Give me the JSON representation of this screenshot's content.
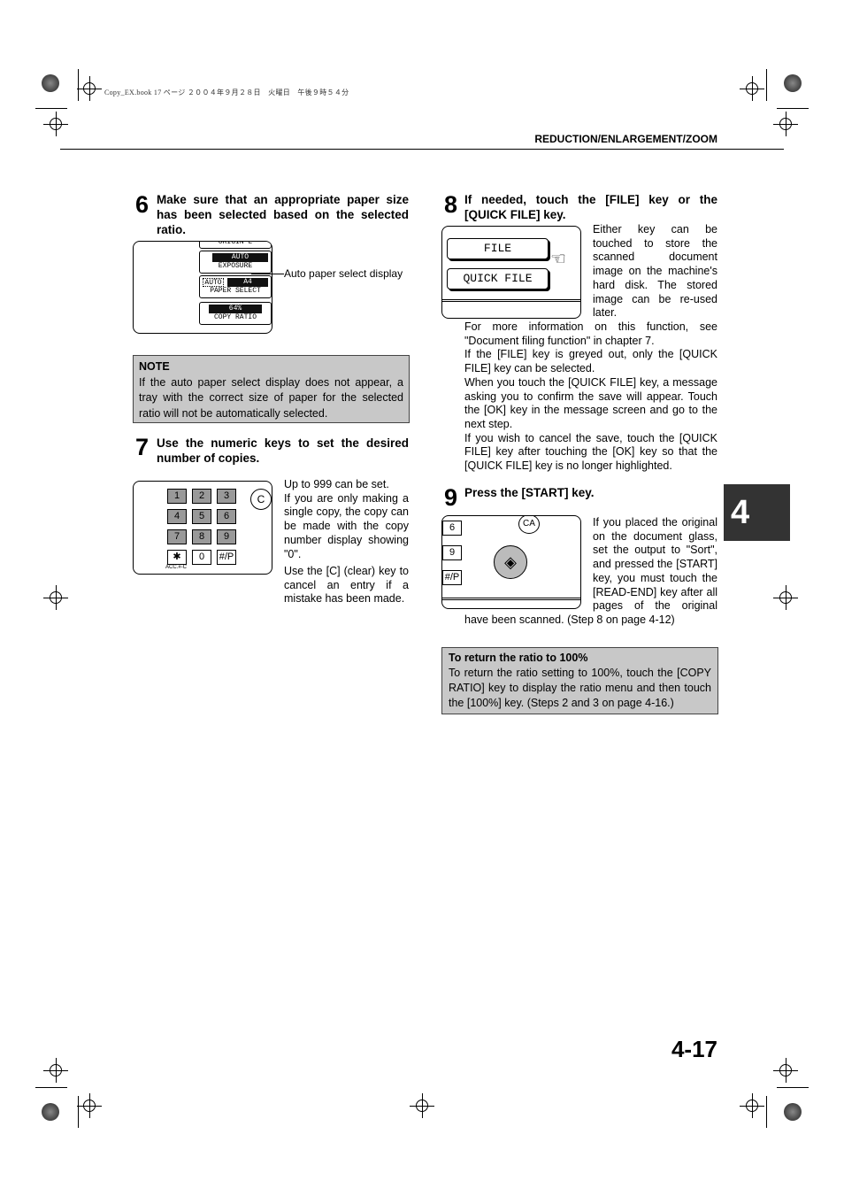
{
  "header": {
    "file_info": "Copy_EX.book  17 ページ  ２００４年９月２８日　火曜日　午後９時５４分",
    "section_title": "REDUCTION/ENLARGEMENT/ZOOM"
  },
  "chapter_tab": "4",
  "page_number": "4-17",
  "step6": {
    "number": "6",
    "heading": "Make sure that an appropriate paper size has been selected based on the selected ratio.",
    "panel": {
      "original": "ORIGIN L",
      "exposure_value": "AUTO",
      "exposure_label": "EXPOSURE",
      "paper_auto": "AUTO",
      "paper_size": "A4",
      "paper_label": "PAPER SELECT",
      "ratio_value": "64%",
      "ratio_label": "COPY RATIO"
    },
    "callout": "Auto paper select display"
  },
  "note": {
    "title": "NOTE",
    "text": "If the auto paper select display does not appear, a tray with the correct size of paper for the selected ratio will not be automatically selected."
  },
  "step7": {
    "number": "7",
    "heading": "Use the numeric keys to set the desired number of copies.",
    "keys": [
      "1",
      "2",
      "3",
      "4",
      "5",
      "6",
      "7",
      "8",
      "9",
      "✱",
      "0",
      "#/P"
    ],
    "clear_key": "C",
    "acc_label": "ACC.#-C",
    "text1": "Up to 999 can be set.",
    "text2": "If you are only making a single copy, the copy can be made with the copy number display showing \"0\".",
    "text3": "Use the [C] (clear) key to cancel an entry if a mistake has been made."
  },
  "step8": {
    "number": "8",
    "heading": "If needed, touch the [FILE] key or the [QUICK FILE] key.",
    "file_key": "FILE",
    "quick_file_key": "QUICK FILE",
    "text1": "Either key can be touched to store the scanned document image on the machine's hard disk. The stored image can be re-used later.",
    "text2": "For more information on this function, see \"Document filing function\" in chapter 7.",
    "text3": "If the [FILE] key is greyed out, only the [QUICK FILE] key can be selected.",
    "text4": "When you touch the [QUICK FILE] key, a message asking you to confirm the save will appear. Touch the [OK] key in the message screen and go to the next step.",
    "text5": "If you wish to cancel the save, touch the [QUICK FILE] key after touching the [OK] key so that the [QUICK FILE] key is no longer highlighted."
  },
  "step9": {
    "number": "9",
    "heading": "Press the [START] key.",
    "keys": [
      "6",
      "9",
      "#/P"
    ],
    "ca_key": "CA",
    "text": "If you placed the original on the document glass, set the output to \"Sort\", and pressed the [START] key, you must touch the [READ-END] key after all pages of the original have been scanned. (Step 8 on page 4-12)"
  },
  "ratio_box": {
    "title": "To return the ratio to 100%",
    "text": "To return the ratio setting to 100%, touch the [COPY RATIO] key to display the ratio menu and then touch the [100%] key. (Steps 2 and 3 on page 4-16.)"
  }
}
